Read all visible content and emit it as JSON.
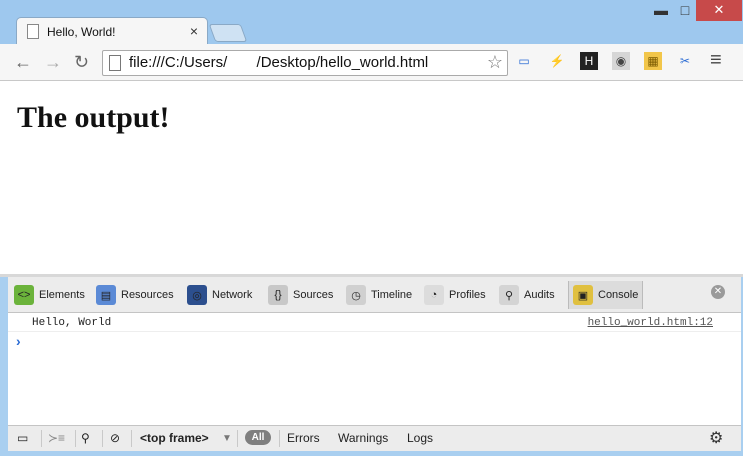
{
  "window": {
    "tab_title": "Hello, World!",
    "close_tab": "×",
    "min": "▬",
    "max": "□",
    "close": "✕"
  },
  "toolbar": {
    "url": "file:///C:/Users/       /Desktop/hello_world.html",
    "back": "←",
    "forward": "→",
    "reload": "↻",
    "star": "☆",
    "menu": "≡"
  },
  "extensions": [
    {
      "name": "screen-capture-icon",
      "glyph": "▭",
      "color": "#2a6bd4"
    },
    {
      "name": "lightning-icon",
      "glyph": "⚡",
      "color": "#222222"
    },
    {
      "name": "h-extension-icon",
      "glyph": "H",
      "color": "#ffffff",
      "bg": "#222222"
    },
    {
      "name": "wayback-icon",
      "glyph": "◉",
      "color": "#444444",
      "bg": "#d6d6d6"
    },
    {
      "name": "ruler-icon",
      "glyph": "▦",
      "color": "#7a5a00",
      "bg": "#f2c64a"
    },
    {
      "name": "scissors-icon",
      "glyph": "✂",
      "color": "#2a6bd4"
    }
  ],
  "page": {
    "heading": "The output!"
  },
  "devtools": {
    "tabs": [
      {
        "label": "Elements",
        "icon": "<>",
        "name": "elements"
      },
      {
        "label": "Resources",
        "icon": "▤",
        "name": "resources"
      },
      {
        "label": "Network",
        "icon": "◎",
        "name": "network"
      },
      {
        "label": "Sources",
        "icon": "{}",
        "name": "sources"
      },
      {
        "label": "Timeline",
        "icon": "◷",
        "name": "timeline"
      },
      {
        "label": "Profiles",
        "icon": "◔",
        "name": "profiles"
      },
      {
        "label": "Audits",
        "icon": "⚲",
        "name": "audits"
      },
      {
        "label": "Console",
        "icon": "▣",
        "name": "console"
      }
    ],
    "active_tab": "Console",
    "close": "✕",
    "console": {
      "message": "Hello, World",
      "source": "hello_world.html:12",
      "prompt": "›"
    },
    "statusbar": {
      "frame": "<top frame>",
      "all": "All",
      "errors": "Errors",
      "warnings": "Warnings",
      "logs": "Logs",
      "dock_icon": "▭",
      "exec_icon": "≻≡",
      "search_icon": "⚲",
      "clear_icon": "⊘",
      "dropdown": "▼",
      "gear": "⚙"
    }
  },
  "colors": {
    "window_frame": "#a9cff0",
    "close_red": "#c74a4a",
    "prompt_blue": "#2a6bd4"
  }
}
